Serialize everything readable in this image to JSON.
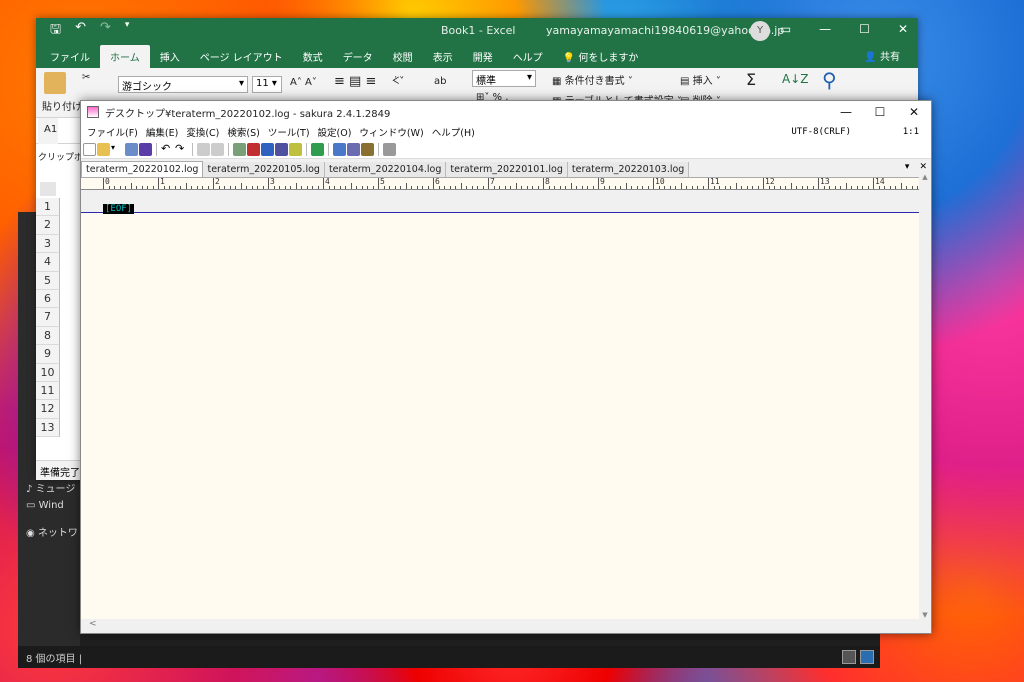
{
  "explorer": {
    "left_items": [
      "ミュージ",
      "Wind",
      "ネットワ"
    ],
    "status": "8 個の項目  |"
  },
  "excel": {
    "title": "Book1  -  Excel",
    "account": "yamayamayamachi19840619@yahoo.co.jp",
    "avatar_initial": "Y",
    "tabs": [
      "ファイル",
      "ホーム",
      "挿入",
      "ページ レイアウト",
      "数式",
      "データ",
      "校閲",
      "表示",
      "開発",
      "ヘルプ",
      "何をしますか"
    ],
    "share": "共有",
    "ribbon": {
      "paste": "貼り付け",
      "clipboard": "クリップボード",
      "font_name": "游ゴシック",
      "font_size": "11",
      "number_format": "標準",
      "conditional": "条件付き書式",
      "table_format": "テーブルとして書式設定",
      "insert": "挿入",
      "delete": "削除"
    },
    "name_box": "A1",
    "rows": [
      "1",
      "2",
      "3",
      "4",
      "5",
      "6",
      "7",
      "8",
      "9",
      "10",
      "11",
      "12",
      "13"
    ],
    "status": "準備完了"
  },
  "sakura": {
    "title": "デスクトップ¥teraterm_20220102.log - sakura 2.4.1.2849",
    "menu": [
      "ファイル(F)",
      "編集(E)",
      "変換(C)",
      "検索(S)",
      "ツール(T)",
      "設定(O)",
      "ウィンドウ(W)",
      "ヘルプ(H)"
    ],
    "encoding": "UTF-8(CRLF)",
    "cursor_pos": "1:1",
    "tabs": [
      "teraterm_20220102.log",
      "teraterm_20220105.log",
      "teraterm_20220104.log",
      "teraterm_20220101.log",
      "teraterm_20220103.log"
    ],
    "active_tab": 0,
    "ruler_numbers": [
      "0",
      "1",
      "2",
      "3",
      "4",
      "5",
      "6",
      "7",
      "8",
      "9",
      "10",
      "11",
      "12",
      "13",
      "14"
    ],
    "eof_marker": "[EOF]"
  }
}
